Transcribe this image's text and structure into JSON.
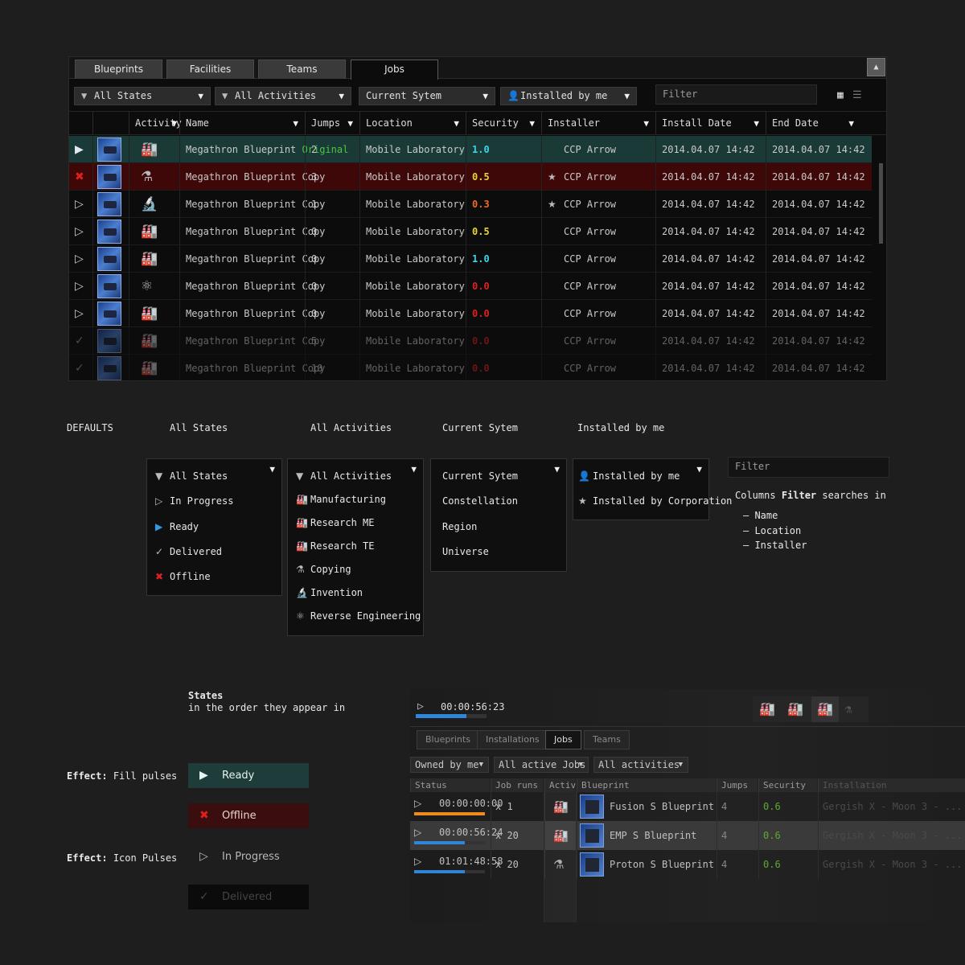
{
  "tabs": [
    "Blueprints",
    "Facilities",
    "Teams",
    "Jobs"
  ],
  "filters": {
    "states": "All States",
    "activities": "All Activities",
    "system": "Current Sytem",
    "installed": "Installed by me",
    "filter_placeholder": "Filter"
  },
  "columns": [
    "Activity",
    "Name",
    "Jumps",
    "Location",
    "Security",
    "Installer",
    "Install Date",
    "End Date"
  ],
  "rows": [
    {
      "status": "▶",
      "activity": "🏭",
      "name": "Megathron Blueprint",
      "tag": "Original",
      "jumps": "2",
      "location": "Mobile Laboratory",
      "security": "1.0",
      "installer": "CCP Arrow",
      "star": "",
      "install": "2014.04.07 14:42",
      "end": "2014.04.07 14:42"
    },
    {
      "status": "✖",
      "activity": "⚗",
      "name": "Megathron Blueprint Copy",
      "tag": "",
      "jumps": "3",
      "location": "Mobile Laboratory",
      "security": "0.5",
      "installer": "CCP Arrow",
      "star": "★",
      "install": "2014.04.07 14:42",
      "end": "2014.04.07 14:42"
    },
    {
      "status": "▷",
      "activity": "🔬",
      "name": "Megathron Blueprint Copy",
      "tag": "",
      "jumps": "1",
      "location": "Mobile Laboratory",
      "security": "0.3",
      "installer": "CCP Arrow",
      "star": "★",
      "install": "2014.04.07 14:42",
      "end": "2014.04.07 14:42"
    },
    {
      "status": "▷",
      "activity": "🏭",
      "name": "Megathron Blueprint Copy",
      "tag": "",
      "jumps": "0",
      "location": "Mobile Laboratory",
      "security": "0.5",
      "installer": "CCP Arrow",
      "star": "",
      "install": "2014.04.07 14:42",
      "end": "2014.04.07 14:42"
    },
    {
      "status": "▷",
      "activity": "🏭",
      "name": "Megathron Blueprint Copy",
      "tag": "",
      "jumps": "0",
      "location": "Mobile Laboratory",
      "security": "1.0",
      "installer": "CCP Arrow",
      "star": "",
      "install": "2014.04.07 14:42",
      "end": "2014.04.07 14:42"
    },
    {
      "status": "▷",
      "activity": "⚛",
      "name": "Megathron Blueprint Copy",
      "tag": "",
      "jumps": "0",
      "location": "Mobile Laboratory",
      "security": "0.0",
      "installer": "CCP Arrow",
      "star": "",
      "install": "2014.04.07 14:42",
      "end": "2014.04.07 14:42"
    },
    {
      "status": "▷",
      "activity": "🏭",
      "name": "Megathron Blueprint Copy",
      "tag": "",
      "jumps": "0",
      "location": "Mobile Laboratory",
      "security": "0.0",
      "installer": "CCP Arrow",
      "star": "",
      "install": "2014.04.07 14:42",
      "end": "2014.04.07 14:42"
    },
    {
      "status": "✓",
      "activity": "🏭",
      "name": "Megathron Blueprint Copy",
      "tag": "",
      "jumps": "5",
      "location": "Mobile Laboratory",
      "security": "0.0",
      "installer": "CCP Arrow",
      "star": "",
      "install": "2014.04.07 14:42",
      "end": "2014.04.07 14:42"
    },
    {
      "status": "✓",
      "activity": "🏭",
      "name": "Megathron Blueprint Copy",
      "tag": "",
      "jumps": "10",
      "location": "Mobile Laboratory",
      "security": "0.0",
      "installer": "CCP Arrow",
      "star": "",
      "install": "2014.04.07 14:42",
      "end": "2014.04.07 14:42"
    }
  ],
  "defaults": {
    "title": "DEFAULTS",
    "labels": [
      "All States",
      "All Activities",
      "Current Sytem",
      "Installed by me"
    ],
    "states_menu": [
      "All States",
      "In Progress",
      "Ready",
      "Delivered",
      "Offline"
    ],
    "activities_menu": [
      "All Activities",
      "Manufacturing",
      "Research ME",
      "Research TE",
      "Copying",
      "Invention",
      "Reverse Engineering"
    ],
    "system_menu": [
      "Current Sytem",
      "Constellation",
      "Region",
      "Universe"
    ],
    "installed_menu": [
      "Installed by me",
      "Installed by Corporation"
    ],
    "filter_placeholder": "Filter",
    "filter_note_pre": "Columns",
    "filter_note_bold": "Filter",
    "filter_note_post": "searches in",
    "filter_fields": [
      "Name",
      "Location",
      "Installer"
    ]
  },
  "states_note": {
    "title": "States",
    "subtitle": "in the order they appear in"
  },
  "effects": {
    "fill_label_bold": "Effect:",
    "fill_label": "Fill pulses",
    "icon_label_bold": "Effect:",
    "icon_label": "Icon Pulses",
    "ready": "Ready",
    "offline": "Offline",
    "in_progress": "In Progress",
    "delivered": "Delivered"
  },
  "mini": {
    "timer": "00:00:56:23",
    "tabs": [
      "Blueprints",
      "Installations",
      "Jobs",
      "Teams"
    ],
    "drops": [
      "Owned by me",
      "All active Jobs",
      "All activities"
    ],
    "headers": [
      "Status",
      "Job runs",
      "Activi",
      "Blueprint",
      "Jumps",
      "Security",
      "Installation"
    ],
    "rows": [
      {
        "time": "00:00:00:00",
        "runs": "x 1",
        "blueprint": "Fusion S Blueprint",
        "jumps": "4",
        "security": "0.6",
        "installation": "Gergish X - Moon 3 - ...",
        "progress": 1.0,
        "color": "#f08a1a"
      },
      {
        "time": "00:00:56:24",
        "runs": "x 20",
        "blueprint": "EMP S Blueprint",
        "jumps": "4",
        "security": "0.6",
        "installation": "Gergish X - Moon 3 - ...",
        "progress": 0.72,
        "color": "#2f86d8"
      },
      {
        "time": "01:01:48:58",
        "runs": "x 20",
        "blueprint": "Proton S Blueprint",
        "jumps": "4",
        "security": "0.6",
        "installation": "Gergish X - Moon 3 - ...",
        "progress": 0.72,
        "color": "#2f86d8"
      }
    ]
  },
  "colors": {
    "ready": "#1e3c3a",
    "offline": "#3e0808",
    "accent_blue": "#2f86d8",
    "security_green": "#5fa830"
  }
}
